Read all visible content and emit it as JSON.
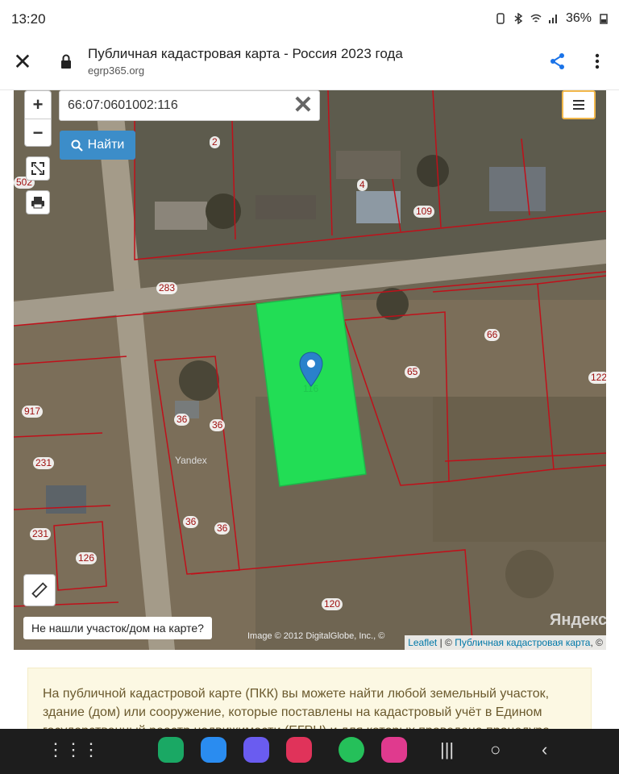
{
  "status": {
    "time": "13:20",
    "battery": "36%"
  },
  "browser": {
    "title": "Публичная кадастровая карта - Россия 2023 года",
    "url": "egrp365.org"
  },
  "map": {
    "zoom_in": "+",
    "zoom_out": "−",
    "search_value": "66:07:0601002:116",
    "find_label": "Найти",
    "not_found_label": "Не нашли участок/дом на карте?",
    "image_credit": "Image © 2012 DigitalGlobe, Inc., ©",
    "yandex_watermark": "Яндекс",
    "yandex_small": "Yandex",
    "attribution": {
      "leaflet": "Leaflet",
      "sep": " | © ",
      "pkk": "Публичная кадастровая карта",
      "tail": ", ©"
    },
    "plot_labels": [
      "2",
      "4",
      "109",
      "502",
      "283",
      "66",
      "65",
      "122",
      "917",
      "36",
      "36",
      "231",
      "231",
      "126",
      "36",
      "36",
      "120"
    ],
    "selected_plot_number": "116"
  },
  "info_text": "На публичной кадастровой карте (ПКК) вы можете найти любой земельный участок, здание (дом) или сооружение, которые поставлены на кадастровый учёт в Едином государственный реестр недвижимости (ЕГРН) и для которых проведена процедура",
  "colors": {
    "selected_plot": "#22dd55",
    "boundary": "#c0101a",
    "find_button": "#3c8dc9"
  },
  "icons": [
    "close-icon",
    "lock-icon",
    "share-icon",
    "more-icon",
    "fullscreen-icon",
    "print-icon",
    "layers-icon",
    "ruler-icon",
    "search-icon",
    "map-marker-icon"
  ]
}
